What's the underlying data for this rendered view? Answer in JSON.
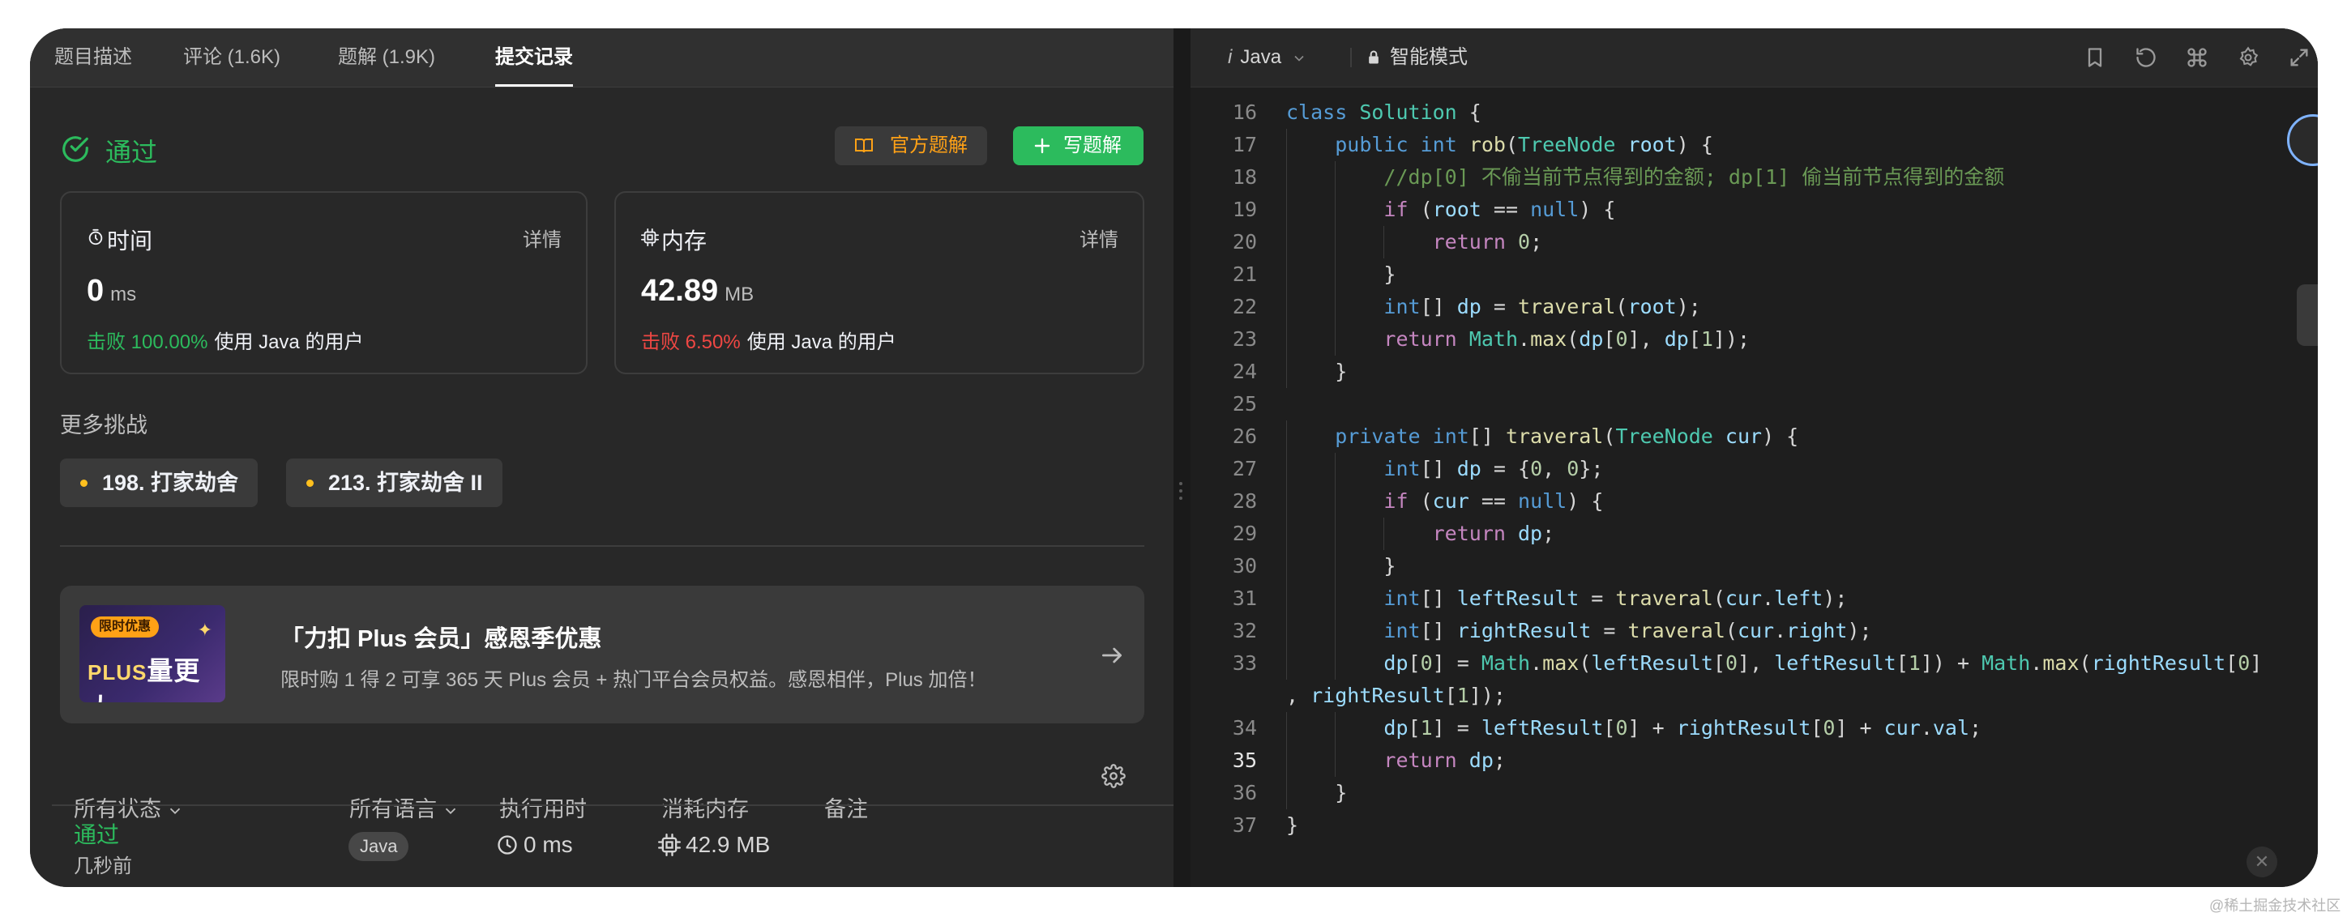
{
  "tabs": [
    {
      "label": "题目描述"
    },
    {
      "label": "评论 (1.6K)"
    },
    {
      "label": "题解 (1.9K)"
    },
    {
      "label": "提交记录",
      "active": true
    }
  ],
  "result": {
    "status": "通过",
    "official_button": "官方题解",
    "write_button": "写题解",
    "status_color": "#2cbb5d"
  },
  "runtime_card": {
    "title": "时间",
    "detail": "详情",
    "value": "0",
    "unit": "ms",
    "beat_percent": "击败 100.00%",
    "beat_rest": "使用 Java 的用户"
  },
  "memory_card": {
    "title": "内存",
    "detail": "详情",
    "value": "42.89",
    "unit": "MB",
    "beat_percent": "击败 6.50%",
    "beat_rest": "使用 Java 的用户"
  },
  "more_challenges": {
    "title": "更多挑战",
    "items": [
      "198. 打家劫舍",
      "213. 打家劫舍 II"
    ]
  },
  "promo": {
    "tag": "限时优惠",
    "logo_prefix": "PLUS",
    "logo_text": "量更大",
    "title": "「力扣 Plus 会员」感恩季优惠",
    "desc": "限时购 1 得 2 可享 365 天 Plus 会员 + 热门平台会员权益。感恩相伴，Plus 加倍！"
  },
  "submissions_table": {
    "headers": [
      "所有状态",
      "所有语言",
      "执行用时",
      "消耗内存",
      "备注"
    ],
    "rows": [
      {
        "status": "通过",
        "time": "几秒前",
        "language": "Java",
        "runtime": "0 ms",
        "memory": "42.9 MB"
      }
    ]
  },
  "editor": {
    "language": "Java",
    "language_prefix": "i",
    "mode": "智能模式",
    "current_line": 35,
    "lines": [
      {
        "n": "16",
        "text": "class Solution {"
      },
      {
        "n": "17",
        "text": "    public int rob(TreeNode root) {"
      },
      {
        "n": "18",
        "text": "        //dp[0] 不偷当前节点得到的金额; dp[1] 偷当前节点得到的金额"
      },
      {
        "n": "19",
        "text": "        if (root == null) {"
      },
      {
        "n": "20",
        "text": "            return 0;"
      },
      {
        "n": "21",
        "text": "        }"
      },
      {
        "n": "22",
        "text": "        int[] dp = traveral(root);"
      },
      {
        "n": "23",
        "text": "        return Math.max(dp[0], dp[1]);"
      },
      {
        "n": "24",
        "text": "    }"
      },
      {
        "n": "25",
        "text": ""
      },
      {
        "n": "26",
        "text": "    private int[] traveral(TreeNode cur) {"
      },
      {
        "n": "27",
        "text": "        int[] dp = {0, 0};"
      },
      {
        "n": "28",
        "text": "        if (cur == null) {"
      },
      {
        "n": "29",
        "text": "            return dp;"
      },
      {
        "n": "30",
        "text": "        }"
      },
      {
        "n": "31",
        "text": "        int[] leftResult = traveral(cur.left);"
      },
      {
        "n": "32",
        "text": "        int[] rightResult = traveral(cur.right);"
      },
      {
        "n": "33",
        "text": "        dp[0] = Math.max(leftResult[0], leftResult[1]) + Math.max(rightResult[0]"
      },
      {
        "n": "",
        "text": ", rightResult[1]);"
      },
      {
        "n": "34",
        "text": "        dp[1] = leftResult[0] + rightResult[0] + cur.val;"
      },
      {
        "n": "35",
        "text": "        return dp;"
      },
      {
        "n": "36",
        "text": "    }"
      },
      {
        "n": "37",
        "text": "}"
      }
    ]
  },
  "watermark": "@稀土掘金技术社区",
  "colors": {
    "accent_green": "#2cbb5d",
    "accent_orange": "#ffa116",
    "fail_red": "#ef4743",
    "challenge_dot": "#ffc01e"
  },
  "icons": [
    "circle-check-icon",
    "book-icon",
    "plus-icon",
    "stopwatch-icon",
    "chip-icon",
    "arrow-right-icon",
    "chevron-down-icon",
    "gear-icon",
    "clock-icon",
    "lock-icon",
    "bookmark-icon",
    "reset-icon",
    "command-icon",
    "expand-icon",
    "close-icon"
  ]
}
